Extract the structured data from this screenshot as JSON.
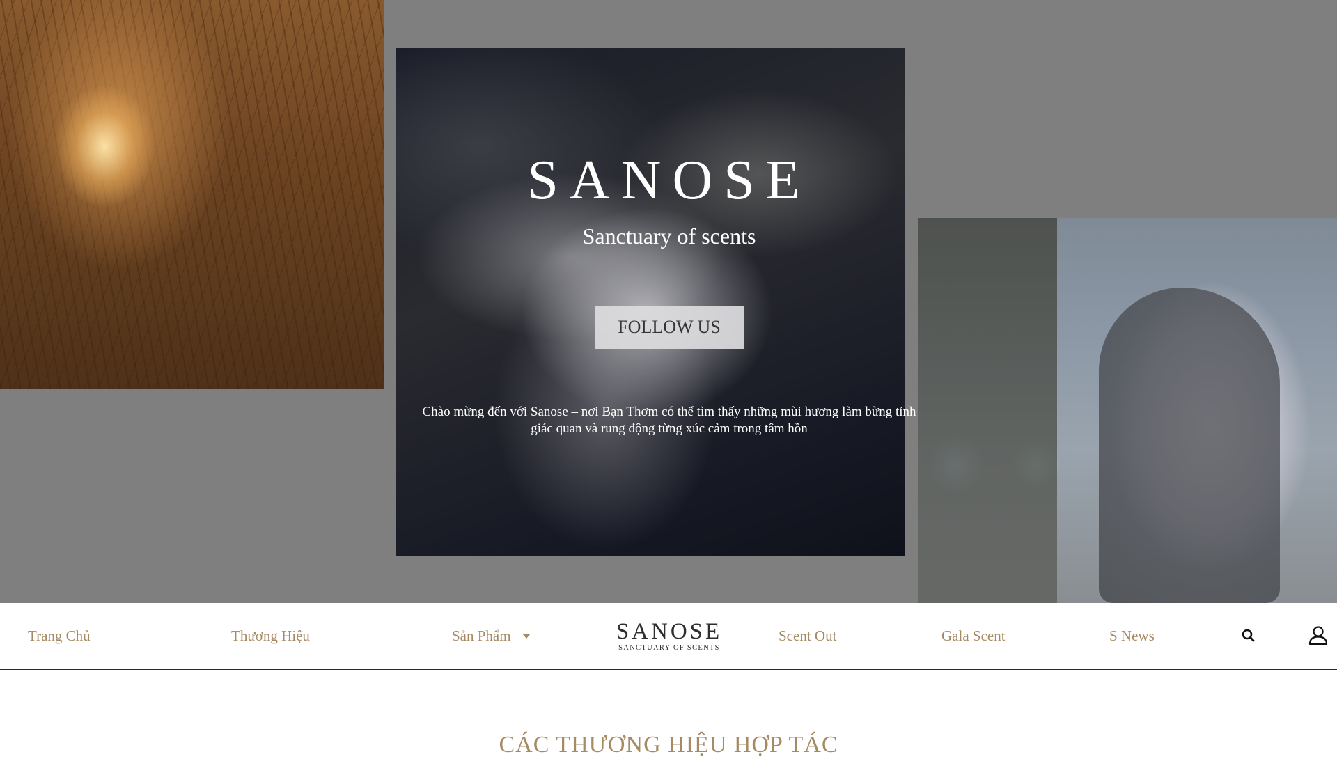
{
  "hero": {
    "brand": "SANOSE",
    "tagline": "Sanctuary of scents",
    "follow_button": "FOLLOW US",
    "welcome_line1": "Chào mừng đến với Sanose – nơi Bạn Thơm có thể tìm thấy những mùi hương làm bừng tỉnh",
    "welcome_line2": "giác quan và rung động từng xúc cảm trong tâm hồn"
  },
  "nav": {
    "items": [
      {
        "label": "Trang Chủ"
      },
      {
        "label": "Thương Hiệu"
      },
      {
        "label": "Sản Phẩm"
      },
      {
        "label": "Scent Out"
      },
      {
        "label": "Gala Scent"
      },
      {
        "label": "S News"
      }
    ],
    "logo_word": "SANOSE",
    "logo_sub": "SANCTUARY OF SCENTS",
    "search_icon": "search-icon",
    "account_icon": "user-icon"
  },
  "section": {
    "title": "CÁC THƯƠNG HIỆU HỢP TÁC"
  },
  "colors": {
    "accent_gold": "#a68a64",
    "overlay_gray": "#7f7f7f",
    "nav_border": "#2b2b2b"
  }
}
